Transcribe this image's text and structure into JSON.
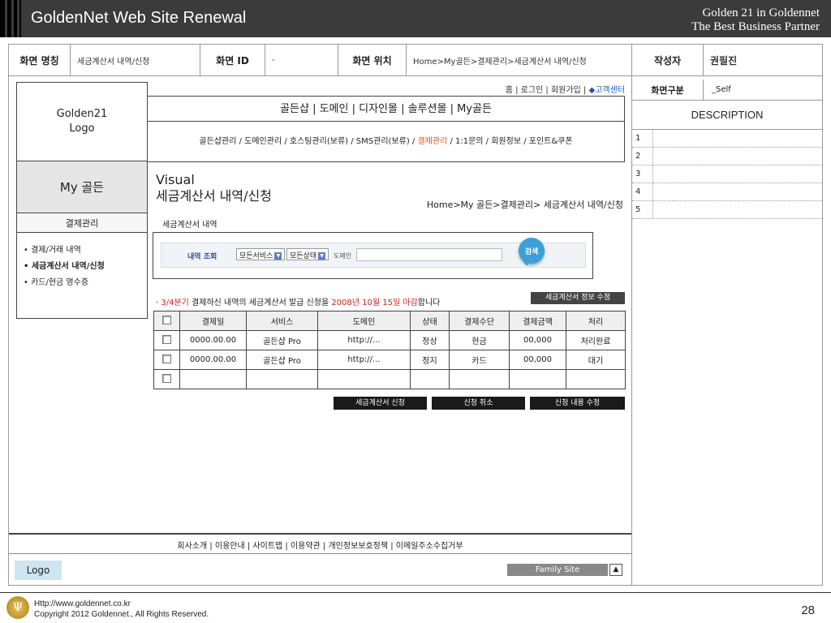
{
  "banner": {
    "title": "GoldenNet Web Site Renewal",
    "tagline_1": "Golden 21 in Goldennet",
    "tagline_2": "The Best Business Partner"
  },
  "info": {
    "screen_name_label": "화면 명칭",
    "screen_name_value": "세금계산서 내역/신청",
    "screen_id_label": "화면 ID",
    "screen_id_value": "-",
    "location_label": "화면 위치",
    "location_value": "Home>My골든>결제관리>세금계산서 내역/신청",
    "author_label": "작성자",
    "author_value": "권필진"
  },
  "desc": {
    "type_label": "화면구분",
    "type_value": "_Self",
    "heading": "DESCRIPTION",
    "rows": [
      "1",
      "2",
      "3",
      "4",
      "5"
    ]
  },
  "sidebar": {
    "logo_line1": "Golden21",
    "logo_line2": "Logo",
    "section": "My 골든",
    "sub_head": "결제관리",
    "items": [
      "• 결제/거래 내역",
      "• 세금계산서 내역/신청",
      "• 카드/현금 영수증"
    ]
  },
  "util": {
    "links": "홈 | 로그인 | 회원가입 | ",
    "diamond": "◆",
    "center": "고객센터"
  },
  "gnb": {
    "text": "골든샵 | 도메인 | 디자인몰 | 솔루션몰 | My골든"
  },
  "lnb": {
    "before": "골든샵관리 / 도메인관리 / 호스팅관리(보류) / SMS관리(보류) / ",
    "active": "결제관리",
    "after": " / 1:1문의 / 회원정보 / 포인트&쿠폰"
  },
  "visual": {
    "line1": "Visual",
    "line2": "세금계산서 내역/신청",
    "breadcrumb": "Home>My 골든>결제관리> 세금계산서 내역/신청"
  },
  "section_title": "세금계산서 내역",
  "search": {
    "label": "내역 조회",
    "select_service": "모든서비스",
    "select_status": "모든상태",
    "domain_label": "도메인",
    "button": "검색"
  },
  "notice": {
    "bullet": "· ",
    "quarter": "3/4분기",
    "middle": " 결제하신 내역의 세금계산서 발급 신청을 ",
    "deadline": "2008년 10월 15일 마감",
    "end": "합니다"
  },
  "edit_info_button": "세금계산서 정보 수정",
  "table": {
    "headers": [
      "결제일",
      "서비스",
      "도메인",
      "상태",
      "결제수단",
      "결제금액",
      "처리"
    ],
    "rows": [
      [
        "0000.00.00",
        "골든샵 Pro",
        "http://...",
        "정상",
        "현금",
        "00,000",
        "처리완료"
      ],
      [
        "0000.00.00",
        "골든샵 Pro",
        "http://...",
        "정지",
        "카드",
        "00,000",
        "대기"
      ],
      [
        "",
        "",
        "",
        "",
        "",
        "",
        ""
      ]
    ]
  },
  "actions": {
    "apply": "세금계산서 신청",
    "cancel": "신청 취소",
    "modify": "신청 내용 수정"
  },
  "footer": {
    "links": "회사소개 | 이용안내 | 사이트맵 | 이용약관 | 개인정보보호정책 | 이메일주소수집거부",
    "logo": "Logo",
    "family_site": "Family Site",
    "family_arrow": "▲"
  },
  "slide": {
    "url": "Http://www.goldennet.co.kr",
    "copyright": "Copyright 2012 Goldennet., All Rights Reserved.",
    "page": "28",
    "emblem": "Ψ"
  },
  "colors": {
    "banner_bg": "#3b3b3b",
    "highlight_orange": "#e0550e",
    "notice_red": "#d81e1e",
    "search_button": "#3d9fd8",
    "link_blue": "#1a55c4"
  }
}
